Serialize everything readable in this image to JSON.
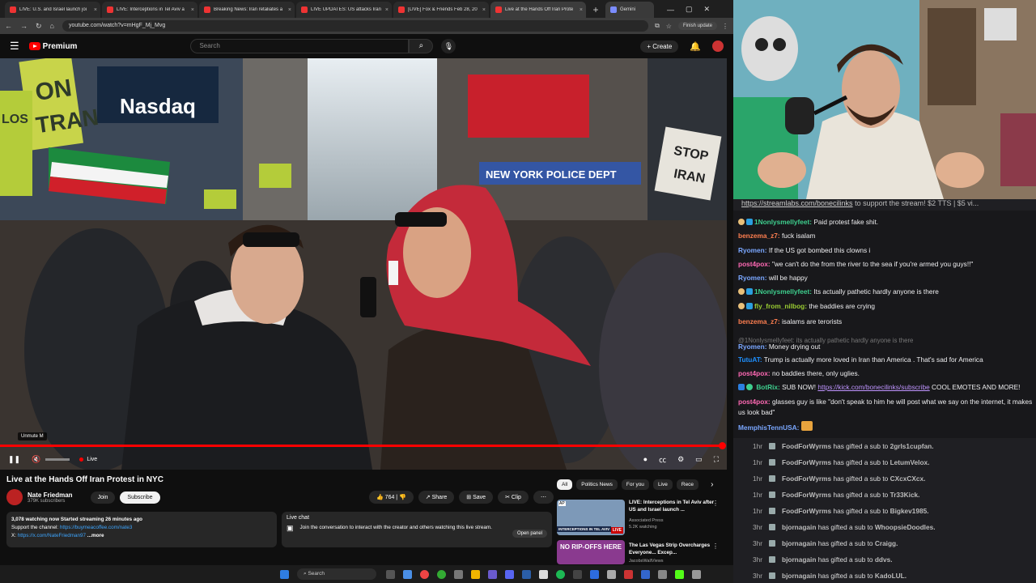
{
  "browser": {
    "tabs": [
      {
        "title": "LIVE: U.S. and Israel launch joi"
      },
      {
        "title": "LIVE: Interceptions in Tel Aviv a"
      },
      {
        "title": "Breaking News: Iran retaliates a"
      },
      {
        "title": "LIVE UPDATES: US attacks Iran"
      },
      {
        "title": "[LIVE] Fox & Friends Feb 28, 20"
      },
      {
        "title": "Live at the Hands Off Iran Prote"
      },
      {
        "title": "Gemini"
      }
    ],
    "url": "youtube.com/watch?v=mHgF_Mj_Mvg",
    "finish_update": "Finish update"
  },
  "youtube": {
    "logo": "Premium",
    "search_placeholder": "Search",
    "create_label": "Create",
    "video": {
      "sign_nasdaq": "Nasdaq",
      "sign_nypd": "NEW YORK POLICE DEPT",
      "sign_stop": "STOP",
      "sign_iran": "IRAN",
      "sign_on": "ON",
      "sign_tran": "TRAN",
      "sign_los": "LOS",
      "live_label": "Live",
      "tooltip": "Unmute  M"
    },
    "title": "Live at the Hands Off Iran Protest in NYC",
    "channel": {
      "name": "Nate Friedman",
      "subs": "379K subscribers",
      "join": "Join",
      "subscribe": "Subscribe"
    },
    "actions": {
      "likes": "764",
      "share": "Share",
      "save": "Save",
      "clip": "Clip"
    },
    "description": {
      "stats": "3,078 watching now  Started streaming 26 minutes ago",
      "support_label": "Support the channel: ",
      "support_link": "https://buymeacoffee.com/nate3",
      "x_label": "X: ",
      "x_link": "https://x.com/NateFriedman97",
      "more": " ...more"
    },
    "live_chat": {
      "title": "Live chat",
      "text": "Join the conversation to interact with the creator and others watching this live stream.",
      "button": "Open panel"
    },
    "chips": [
      "All",
      "Politics News",
      "For you",
      "Live",
      "Rece"
    ],
    "recommendations": [
      {
        "title": "LIVE: Interceptions in Tel Aviv after US and Israel launch ...",
        "channel": "Associated Press",
        "meta": "5.2K watching",
        "badge": "LIVE",
        "thumb_text": "INTERCEPTIONS IN TEL AVIV",
        "thumb_badge": "AP"
      },
      {
        "title": "The Las Vegas Strip Overcharges Everyone... Excep...",
        "channel": "JacobsWallViews",
        "meta": "",
        "badge": "",
        "thumb_text": "NO RIP-OFFS HERE",
        "thumb_badge": ""
      }
    ]
  },
  "taskbar": {
    "search": "Search"
  },
  "stream_chat": {
    "pinned_link": "https://streamlabs.com/bonecilinks",
    "pinned_text": " to support the stream! $2 TTS | $5 vi...",
    "messages": [
      {
        "user": "1Nonlysmellyfeet:",
        "text": "Paid protest fake shit.",
        "color": "#3ecf8e",
        "badges": true
      },
      {
        "user": "benzema_z7:",
        "text": "fuck isalam",
        "color": "#ff7f50",
        "badges": false
      },
      {
        "user": "Ryomen:",
        "text": "If the US got bombed this clowns i",
        "color": "#7aa7ff",
        "badges": false
      },
      {
        "user": "post4pox:",
        "text": "\"we can't do the from the river to the sea if you're armed you guys!!\"",
        "color": "#ff69b4",
        "badges": false
      },
      {
        "user": "Ryomen:",
        "text": "will be happy",
        "color": "#7aa7ff",
        "badges": false
      },
      {
        "user": "1Nonlysmellyfeet:",
        "text": "Its actually pathetic hardly anyone is there",
        "color": "#3ecf8e",
        "badges": true
      },
      {
        "user": "fly_from_nilbog:",
        "text": "the baddies are crying",
        "color": "#9acd32",
        "badges": true
      },
      {
        "user": "benzema_z7:",
        "text": "isalams are terorists",
        "color": "#ff7f50",
        "badges": false
      }
    ],
    "reply_line": "@1Nonlysmellyfeet: its actually pathetic hardly anyone is there",
    "messages2": [
      {
        "user": "Ryomen:",
        "text": "Money drying out",
        "color": "#7aa7ff"
      },
      {
        "user": "TutuAT:",
        "text": "Trump is actually more loved in Iran than America . That's sad for America",
        "color": "#1e90ff"
      },
      {
        "user": "post4pox:",
        "text": "no baddies there, only uglies.",
        "color": "#ff69b4"
      }
    ],
    "bot": {
      "user": "BotRix:",
      "text_before": "SUB NOW! ",
      "link": "https://kick.com/bonecilinks/subscribe",
      "text_after": " COOL EMOTES AND MORE!",
      "color": "#3ecf8e"
    },
    "post4pox_long": {
      "user": "post4pox:",
      "text": "glasses guy is like \"don't speak to him he will post what we say on the internet, it makes us look bad\"",
      "color": "#ff69b4"
    },
    "memphis": {
      "user": "MemphisTennUSA:",
      "color": "#7aa7ff"
    },
    "gift_text": " has gifted a sub to ",
    "gifts": [
      {
        "time": "1hr",
        "user": "FoodForWyrms",
        "recipient": "2grls1cupfan."
      },
      {
        "time": "1hr",
        "user": "FoodForWyrms",
        "recipient": "LetumVelox."
      },
      {
        "time": "1hr",
        "user": "FoodForWyrms",
        "recipient": "CXcxCXcx."
      },
      {
        "time": "1hr",
        "user": "FoodForWyrms",
        "recipient": "Tr33Kick."
      },
      {
        "time": "1hr",
        "user": "FoodForWyrms",
        "recipient": "Bigkev1985."
      },
      {
        "time": "3hr",
        "user": "bjornagain",
        "recipient": "WhoopsieDoodles."
      },
      {
        "time": "3hr",
        "user": "bjornagain",
        "recipient": "Craigg."
      },
      {
        "time": "3hr",
        "user": "bjornagain",
        "recipient": "ddvs."
      },
      {
        "time": "3hr",
        "user": "bjornagain",
        "recipient": "KadoLUL."
      }
    ]
  }
}
